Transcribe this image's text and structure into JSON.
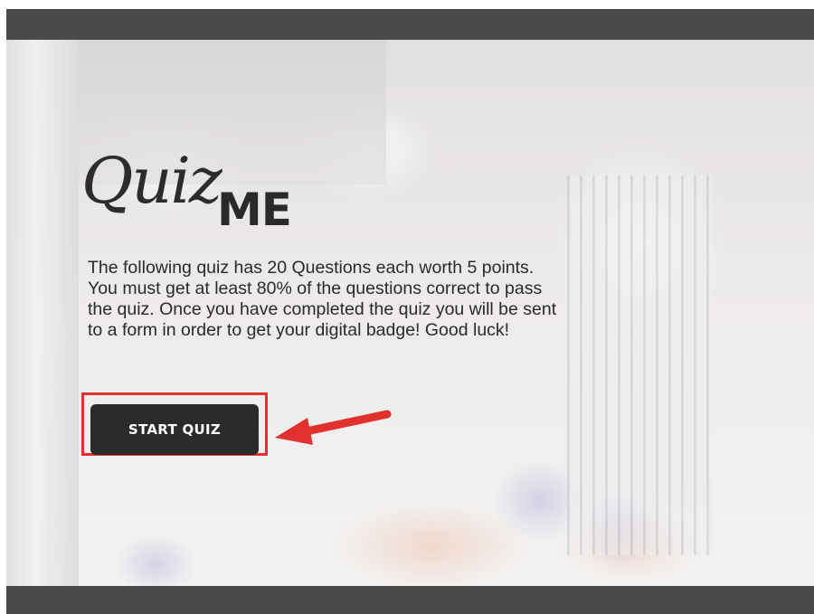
{
  "quiz": {
    "logo_script": "Quiz",
    "logo_block": "ME",
    "intro": "The following quiz has 20 Questions each worth 5 points. You must get at least 80% of the questions correct to pass the quiz. Once you have completed the quiz you will be sent to a form in order to get your digital badge! Good luck!",
    "start_label": "START QUIZ"
  },
  "colors": {
    "bar": "#4a4a4a",
    "button": "#2b2b2b",
    "highlight": "#e0312f"
  },
  "icons": {
    "annotation": "red-arrow-icon"
  }
}
